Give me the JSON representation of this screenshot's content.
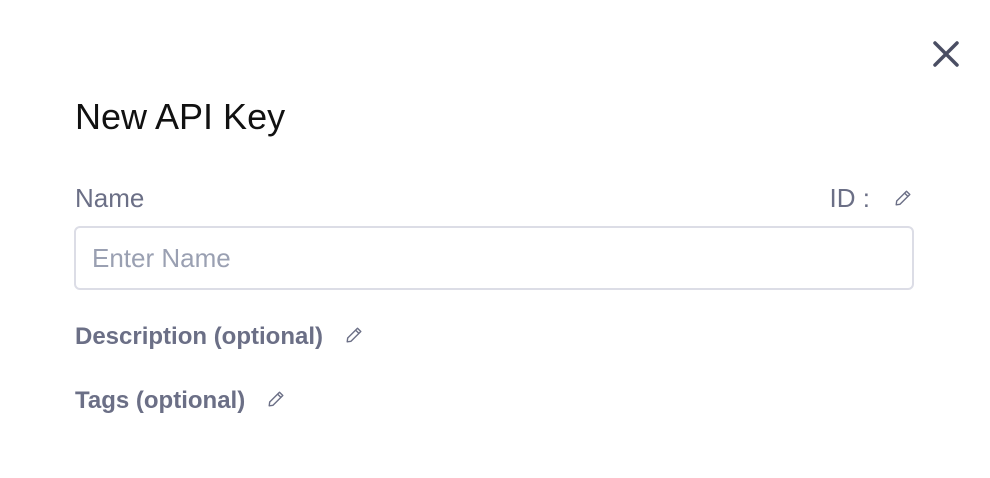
{
  "dialog": {
    "title": "New API Key",
    "close_icon": "close-icon"
  },
  "name_field": {
    "label": "Name",
    "placeholder": "Enter Name",
    "value": ""
  },
  "id_field": {
    "label": "ID :",
    "edit_icon": "pencil-icon"
  },
  "description": {
    "label": "Description (optional)",
    "edit_icon": "pencil-icon"
  },
  "tags": {
    "label": "Tags (optional)",
    "edit_icon": "pencil-icon"
  },
  "colors": {
    "title": "#111111",
    "label": "#6b6f86",
    "placeholder": "#9aa0b2",
    "input_border": "#dcdde6",
    "close_icon": "#4a4e63"
  }
}
